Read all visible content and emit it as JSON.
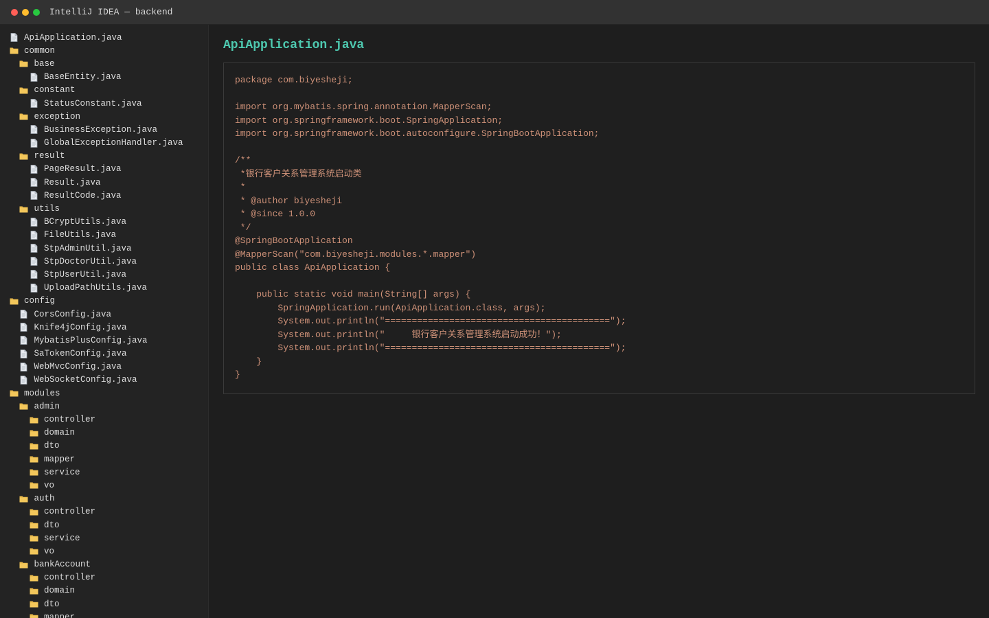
{
  "window": {
    "title": "IntelliJ IDEA — backend",
    "controls": {
      "close_color": "#ff5f57",
      "minimize_color": "#febc2e",
      "maximize_color": "#28c840"
    }
  },
  "sidebar": {
    "items": [
      {
        "label": "ApiApplication.java",
        "type": "file",
        "depth": 0
      },
      {
        "label": "common",
        "type": "folder",
        "depth": 0
      },
      {
        "label": "base",
        "type": "folder",
        "depth": 1
      },
      {
        "label": "BaseEntity.java",
        "type": "file",
        "depth": 2
      },
      {
        "label": "constant",
        "type": "folder",
        "depth": 1
      },
      {
        "label": "StatusConstant.java",
        "type": "file",
        "depth": 2
      },
      {
        "label": "exception",
        "type": "folder",
        "depth": 1
      },
      {
        "label": "BusinessException.java",
        "type": "file",
        "depth": 2
      },
      {
        "label": "GlobalExceptionHandler.java",
        "type": "file",
        "depth": 2
      },
      {
        "label": "result",
        "type": "folder",
        "depth": 1
      },
      {
        "label": "PageResult.java",
        "type": "file",
        "depth": 2
      },
      {
        "label": "Result.java",
        "type": "file",
        "depth": 2
      },
      {
        "label": "ResultCode.java",
        "type": "file",
        "depth": 2
      },
      {
        "label": "utils",
        "type": "folder",
        "depth": 1
      },
      {
        "label": "BCryptUtils.java",
        "type": "file",
        "depth": 2
      },
      {
        "label": "FileUtils.java",
        "type": "file",
        "depth": 2
      },
      {
        "label": "StpAdminUtil.java",
        "type": "file",
        "depth": 2
      },
      {
        "label": "StpDoctorUtil.java",
        "type": "file",
        "depth": 2
      },
      {
        "label": "StpUserUtil.java",
        "type": "file",
        "depth": 2
      },
      {
        "label": "UploadPathUtils.java",
        "type": "file",
        "depth": 2
      },
      {
        "label": "config",
        "type": "folder",
        "depth": 0
      },
      {
        "label": "CorsConfig.java",
        "type": "file",
        "depth": 1
      },
      {
        "label": "Knife4jConfig.java",
        "type": "file",
        "depth": 1
      },
      {
        "label": "MybatisPlusConfig.java",
        "type": "file",
        "depth": 1
      },
      {
        "label": "SaTokenConfig.java",
        "type": "file",
        "depth": 1
      },
      {
        "label": "WebMvcConfig.java",
        "type": "file",
        "depth": 1
      },
      {
        "label": "WebSocketConfig.java",
        "type": "file",
        "depth": 1
      },
      {
        "label": "modules",
        "type": "folder",
        "depth": 0
      },
      {
        "label": "admin",
        "type": "folder",
        "depth": 1
      },
      {
        "label": "controller",
        "type": "folder",
        "depth": 2
      },
      {
        "label": "domain",
        "type": "folder",
        "depth": 2
      },
      {
        "label": "dto",
        "type": "folder",
        "depth": 2
      },
      {
        "label": "mapper",
        "type": "folder",
        "depth": 2
      },
      {
        "label": "service",
        "type": "folder",
        "depth": 2
      },
      {
        "label": "vo",
        "type": "folder",
        "depth": 2
      },
      {
        "label": "auth",
        "type": "folder",
        "depth": 1
      },
      {
        "label": "controller",
        "type": "folder",
        "depth": 2
      },
      {
        "label": "dto",
        "type": "folder",
        "depth": 2
      },
      {
        "label": "service",
        "type": "folder",
        "depth": 2
      },
      {
        "label": "vo",
        "type": "folder",
        "depth": 2
      },
      {
        "label": "bankAccount",
        "type": "folder",
        "depth": 1
      },
      {
        "label": "controller",
        "type": "folder",
        "depth": 2
      },
      {
        "label": "domain",
        "type": "folder",
        "depth": 2
      },
      {
        "label": "dto",
        "type": "folder",
        "depth": 2
      },
      {
        "label": "mapper",
        "type": "folder",
        "depth": 2
      }
    ]
  },
  "editor": {
    "file_title": "ApiApplication.java",
    "lines": [
      "package com.biyesheji;",
      "",
      "import org.mybatis.spring.annotation.MapperScan;",
      "import org.springframework.boot.SpringApplication;",
      "import org.springframework.boot.autoconfigure.SpringBootApplication;",
      "",
      "/**",
      " *银行客户关系管理系统启动类",
      " *",
      " * @author biyesheji",
      " * @since 1.0.0",
      " */",
      "@SpringBootApplication",
      "@MapperScan(\"com.biyesheji.modules.*.mapper\")",
      "public class ApiApplication {",
      "",
      "    public static void main(String[] args) {",
      "        SpringApplication.run(ApiApplication.class, args);",
      "        System.out.println(\"==========================================\");",
      "        System.out.println(\"     银行客户关系管理系统启动成功！\");",
      "        System.out.println(\"==========================================\");",
      "    }",
      "}"
    ]
  },
  "colors": {
    "background": "#1e1e1e",
    "sidebar_bg": "#232323",
    "titlebar_bg": "#323232",
    "title_accent": "#4ec9b0",
    "code_text": "#ce9178",
    "folder_icon": "#e8b84a",
    "file_icon": "#d8dce3"
  }
}
